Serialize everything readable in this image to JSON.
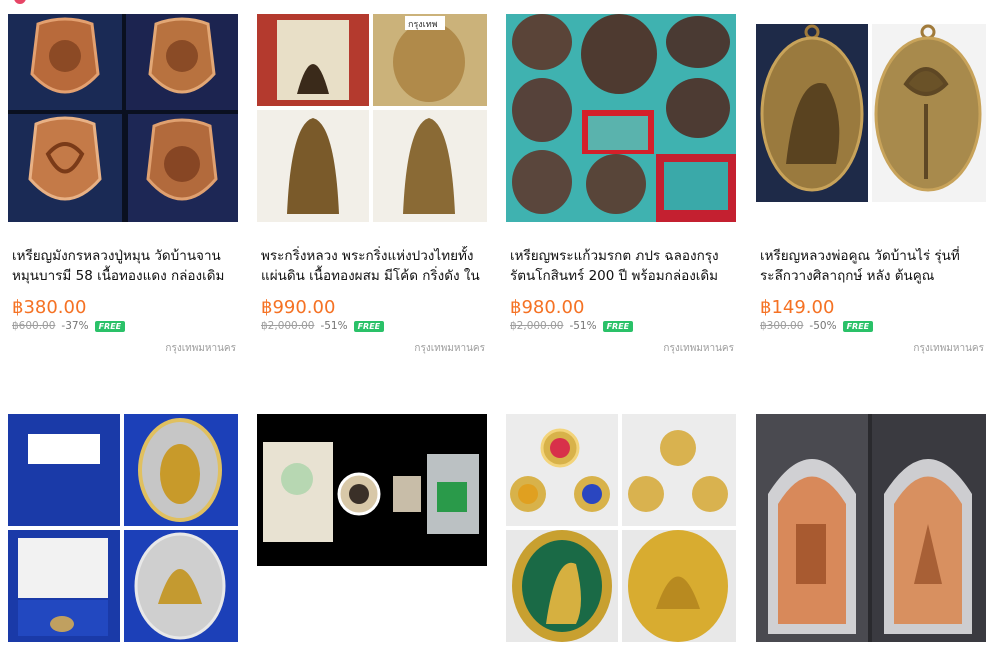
{
  "products": [
    {
      "title": "เหรียญมังกรหลวงปู่หมุน วัดบ้านจาน หมุนบารมี 58 เนื้อทองแดง กล่องเดิม สภาพ...",
      "price": "฿380.00",
      "original_price": "฿600.00",
      "discount": "-37%",
      "shipping": "FREE",
      "location": "กรุงเทพมหานคร",
      "image": "copper-amulet-collage"
    },
    {
      "title": "พระกริ่งหลวง พระกริ่งแห่งปวงไทยทั้งแผ่นดิน เนื้อทองผสม มีโค้ด กริ่งดัง ในกล่อง...",
      "price": "฿990.00",
      "original_price": "฿2,000.00",
      "discount": "-51%",
      "shipping": "FREE",
      "location": "กรุงเทพมหานคร",
      "image": "bronze-buddha-collage",
      "image_text": "กรุงเทพ"
    },
    {
      "title": "เหรียญพระแก้วมรกต ภปร ฉลองกรุงรัตนโกสินทร์ 200 ปี พร้อมกล่องเดิม พิธี...",
      "price": "฿980.00",
      "original_price": "฿2,000.00",
      "discount": "-51%",
      "shipping": "FREE",
      "location": "กรุงเทพมหานคร",
      "image": "emerald-buddha-coin-collage"
    },
    {
      "title": "เหรียญหลวงพ่อคูณ วัดบ้านไร่ รุ่นที่ระลึกวางศิลาฤกษ์ หลัง ต้นคูณ โรงเรียนพระ...",
      "price": "฿149.00",
      "original_price": "฿300.00",
      "discount": "-50%",
      "shipping": "FREE",
      "location": "กรุงเทพมหานคร",
      "image": "brass-oval-medal"
    },
    {
      "image": "silver-medal-blue-box"
    },
    {
      "image": "amulet-set-black-background"
    },
    {
      "image": "gold-enamel-coins"
    },
    {
      "image": "copper-medals-plastic-case"
    }
  ]
}
